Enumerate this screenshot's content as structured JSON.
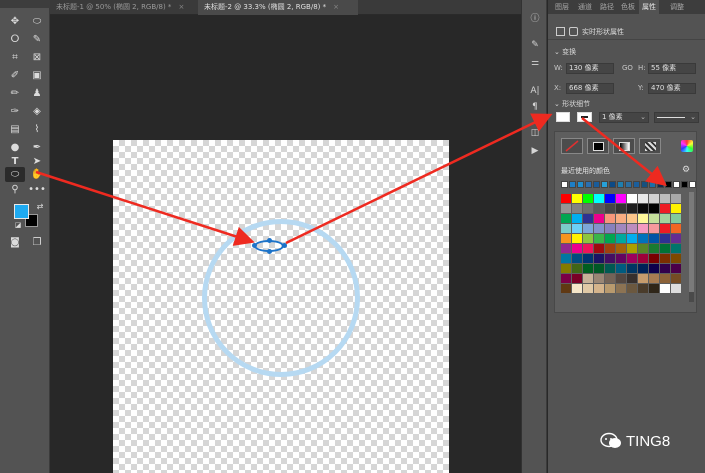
{
  "document_tabs": [
    {
      "label": "未标题-1 @ 50% (椭圆 2, RGB/8) *",
      "close": "×"
    },
    {
      "label": "未标题-2 @ 33.3% (椭圆 2, RGB/8) *",
      "close": "×"
    }
  ],
  "panel_tabs": [
    "图层",
    "通道",
    "路径",
    "色板",
    "属性",
    "调整"
  ],
  "properties": {
    "title": "实时形状属性",
    "transform_section": "变换",
    "w_label": "W:",
    "w_value": "130 像素",
    "link_label": "GO",
    "h_label": "H:",
    "h_value": "55 像素",
    "x_label": "X:",
    "x_value": "668 像素",
    "y_label": "Y:",
    "y_value": "470 像素",
    "shape_section": "形状细节",
    "stroke_width": "1 像素",
    "recent_colors": "最近使用的颜色"
  },
  "tools": {
    "foreground_color": "#1eaaf1",
    "background_color": "#000000",
    "active_tool": "ellipse-tool"
  },
  "canvas": {
    "ring_color": "#b6d9f2",
    "selected_shape_color": "#1d73c9"
  },
  "swatches": {
    "recent": [
      "#ffffff",
      "#1e7fc7",
      "#1e8fd0",
      "#2a6fb0",
      "#1a5c9a",
      "#27a0d8",
      "#0c4a86",
      "#1e7fb0",
      "#2b6fa1",
      "#1b5e9c",
      "#16507e",
      "#1a6ea8",
      "#102b4e",
      "#000000",
      "#ffffff",
      "#000000",
      "#ffffff"
    ],
    "grid": [
      "#ff0000",
      "#ffff00",
      "#00ff00",
      "#00ffff",
      "#0000ff",
      "#ff00ff",
      "#ffffff",
      "#e8e8e8",
      "#d0d0d0",
      "#bcbcbc",
      "#a8a8a8",
      "#959595",
      "#828282",
      "#6e6e6e",
      "#5a5a5a",
      "#464646",
      "#333333",
      "#1f1f1f",
      "#0a0a0a",
      "#000000",
      "#ee1c24",
      "#fff200",
      "#00a651",
      "#00aeef",
      "#2e3192",
      "#ec008c",
      "#f7977a",
      "#f9ad81",
      "#fdc68a",
      "#fff79a",
      "#c4df9b",
      "#a3d39c",
      "#82ca9c",
      "#7accc8",
      "#6dcff6",
      "#7da7d9",
      "#8393ca",
      "#8781bd",
      "#a187be",
      "#bc8dbf",
      "#f49ac2",
      "#f6989d",
      "#ed1c24",
      "#f26522",
      "#f7941d",
      "#fff200",
      "#8dc63f",
      "#39b54a",
      "#00a651",
      "#00a99d",
      "#00aeef",
      "#0072bc",
      "#0054a6",
      "#2e3192",
      "#662d91",
      "#92278f",
      "#ec008c",
      "#ed145b",
      "#9e0b0f",
      "#a0410d",
      "#a36209",
      "#aba000",
      "#598527",
      "#1a7b30",
      "#007236",
      "#00746b",
      "#0076a3",
      "#004b80",
      "#003471",
      "#1b1464",
      "#440e62",
      "#630460",
      "#9e005d",
      "#9e0039",
      "#790000",
      "#7b2e00",
      "#7d4900",
      "#827b00",
      "#406618",
      "#005e20",
      "#005826",
      "#005952",
      "#005b7f",
      "#003663",
      "#002157",
      "#0d004c",
      "#32004b",
      "#4b0049",
      "#7b0046",
      "#7a0026",
      "#c7b299",
      "#998675",
      "#736357",
      "#534741",
      "#37302d",
      "#c69c6d",
      "#a67c52",
      "#8c6239",
      "#754c24",
      "#603913",
      "#f5e6c8",
      "#e0c9a6",
      "#d4b48c",
      "#b89a6e",
      "#8c7353",
      "#6b583f",
      "#4a3c2b",
      "#2f2619",
      "#ffffff",
      "#dddddd"
    ]
  },
  "watermark": "TING8"
}
